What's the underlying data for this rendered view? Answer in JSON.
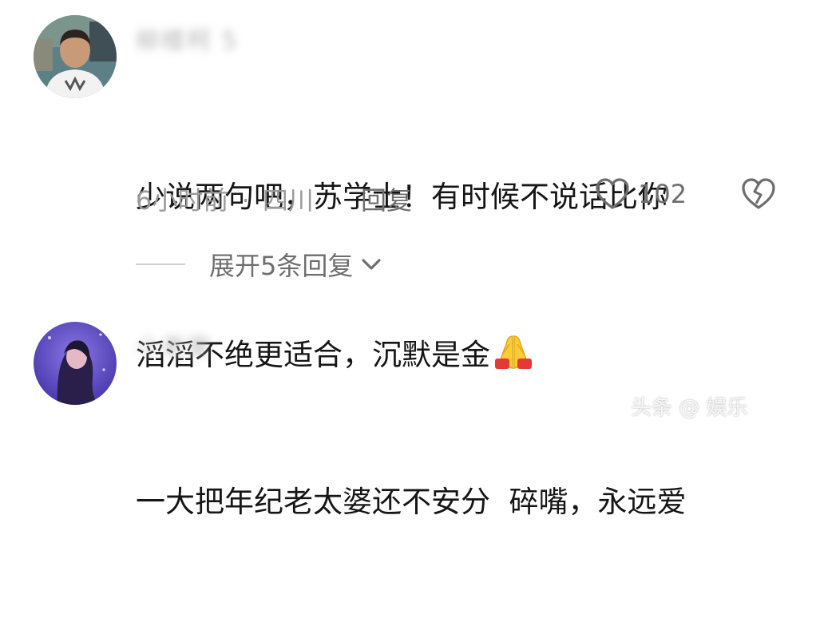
{
  "comments": [
    {
      "username": "柳楼柯 5",
      "content_line1": "少说两句吧，苏学士！有时候不说话比你",
      "content_line2": "滔滔不绝更适合，沉默是金",
      "emoji_icon": "folded-hands-icon",
      "time": "6小时前",
      "separator": "·",
      "location": "四川",
      "reply_label": "回复",
      "likes": "102",
      "expand_label": "展开5条回复"
    },
    {
      "username": "小老家",
      "content_line1": "一大把年纪老太婆还不安分  碎嘴，永远爱"
    }
  ],
  "watermark": "头条 @ 娱乐"
}
